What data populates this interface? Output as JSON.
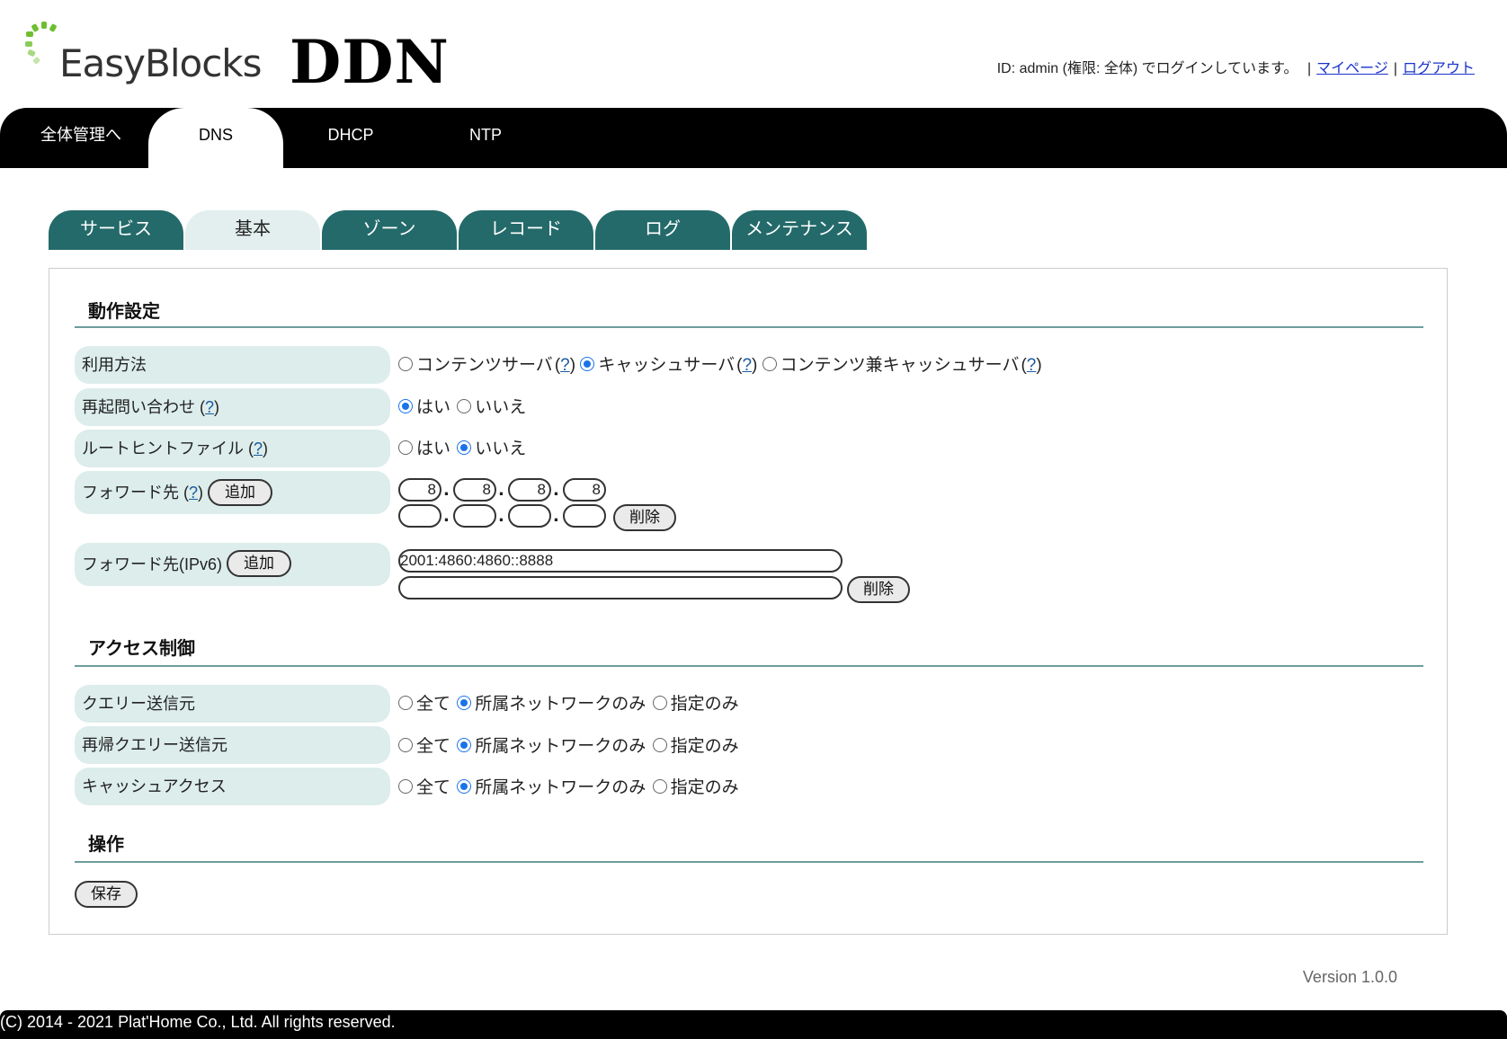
{
  "header": {
    "logo_text": "EasyBlocks",
    "app_title": "DDN",
    "login_text": "ID: admin (権限: 全体) でログインしています。",
    "separator": "|",
    "mypage_link": "マイページ",
    "logout_link": "ログアウト"
  },
  "main_nav": {
    "tabs": [
      {
        "label": "全体管理へ",
        "active": false
      },
      {
        "label": "DNS",
        "active": true
      },
      {
        "label": "DHCP",
        "active": false
      },
      {
        "label": "NTP",
        "active": false
      }
    ]
  },
  "sub_tabs": [
    {
      "label": "サービス",
      "active": false
    },
    {
      "label": "基本",
      "active": true
    },
    {
      "label": "ゾーン",
      "active": false
    },
    {
      "label": "レコード",
      "active": false
    },
    {
      "label": "ログ",
      "active": false
    },
    {
      "label": "メンテナンス",
      "active": false
    }
  ],
  "help_mark": "?",
  "operation_settings": {
    "title": "動作設定",
    "usage": {
      "label": "利用方法",
      "options": [
        "コンテンツサーバ",
        "キャッシュサーバ",
        "コンテンツ兼キャッシュサーバ"
      ],
      "selected": "キャッシュサーバ"
    },
    "recursive": {
      "label": "再起問い合わせ",
      "options": [
        "はい",
        "いいえ"
      ],
      "selected": "はい"
    },
    "root_hint": {
      "label": "ルートヒントファイル",
      "options": [
        "はい",
        "いいえ"
      ],
      "selected": "いいえ"
    },
    "forwarders": {
      "label": "フォワード先",
      "add_button": "追加",
      "delete_button": "削除",
      "ipv4_row1": [
        "8",
        "8",
        "8",
        "8"
      ],
      "ipv4_row2": [
        "",
        "",
        "",
        ""
      ]
    },
    "forwarders_v6": {
      "label": "フォワード先(IPv6)",
      "add_button": "追加",
      "delete_button": "削除",
      "values": [
        "2001:4860:4860::8888",
        ""
      ]
    }
  },
  "access_control": {
    "title": "アクセス制御",
    "options": [
      "全て",
      "所属ネットワークのみ",
      "指定のみ"
    ],
    "rows": [
      {
        "label": "クエリー送信元",
        "selected": "所属ネットワークのみ"
      },
      {
        "label": "再帰クエリー送信元",
        "selected": "所属ネットワークのみ"
      },
      {
        "label": "キャッシュアクセス",
        "selected": "所属ネットワークのみ"
      }
    ]
  },
  "operations": {
    "title": "操作",
    "save_button": "保存"
  },
  "version": "Version 1.0.0",
  "footer": "(C) 2014 - 2021 Plat'Home Co., Ltd. All rights reserved.",
  "colors": {
    "tab_teal": "#246a6a",
    "tab_active": "#e2efee",
    "label_bg": "#dcedeb",
    "radio_checked": "#1a73e8",
    "link": "#1a33cc",
    "logo_green": "#6dbf2f"
  }
}
